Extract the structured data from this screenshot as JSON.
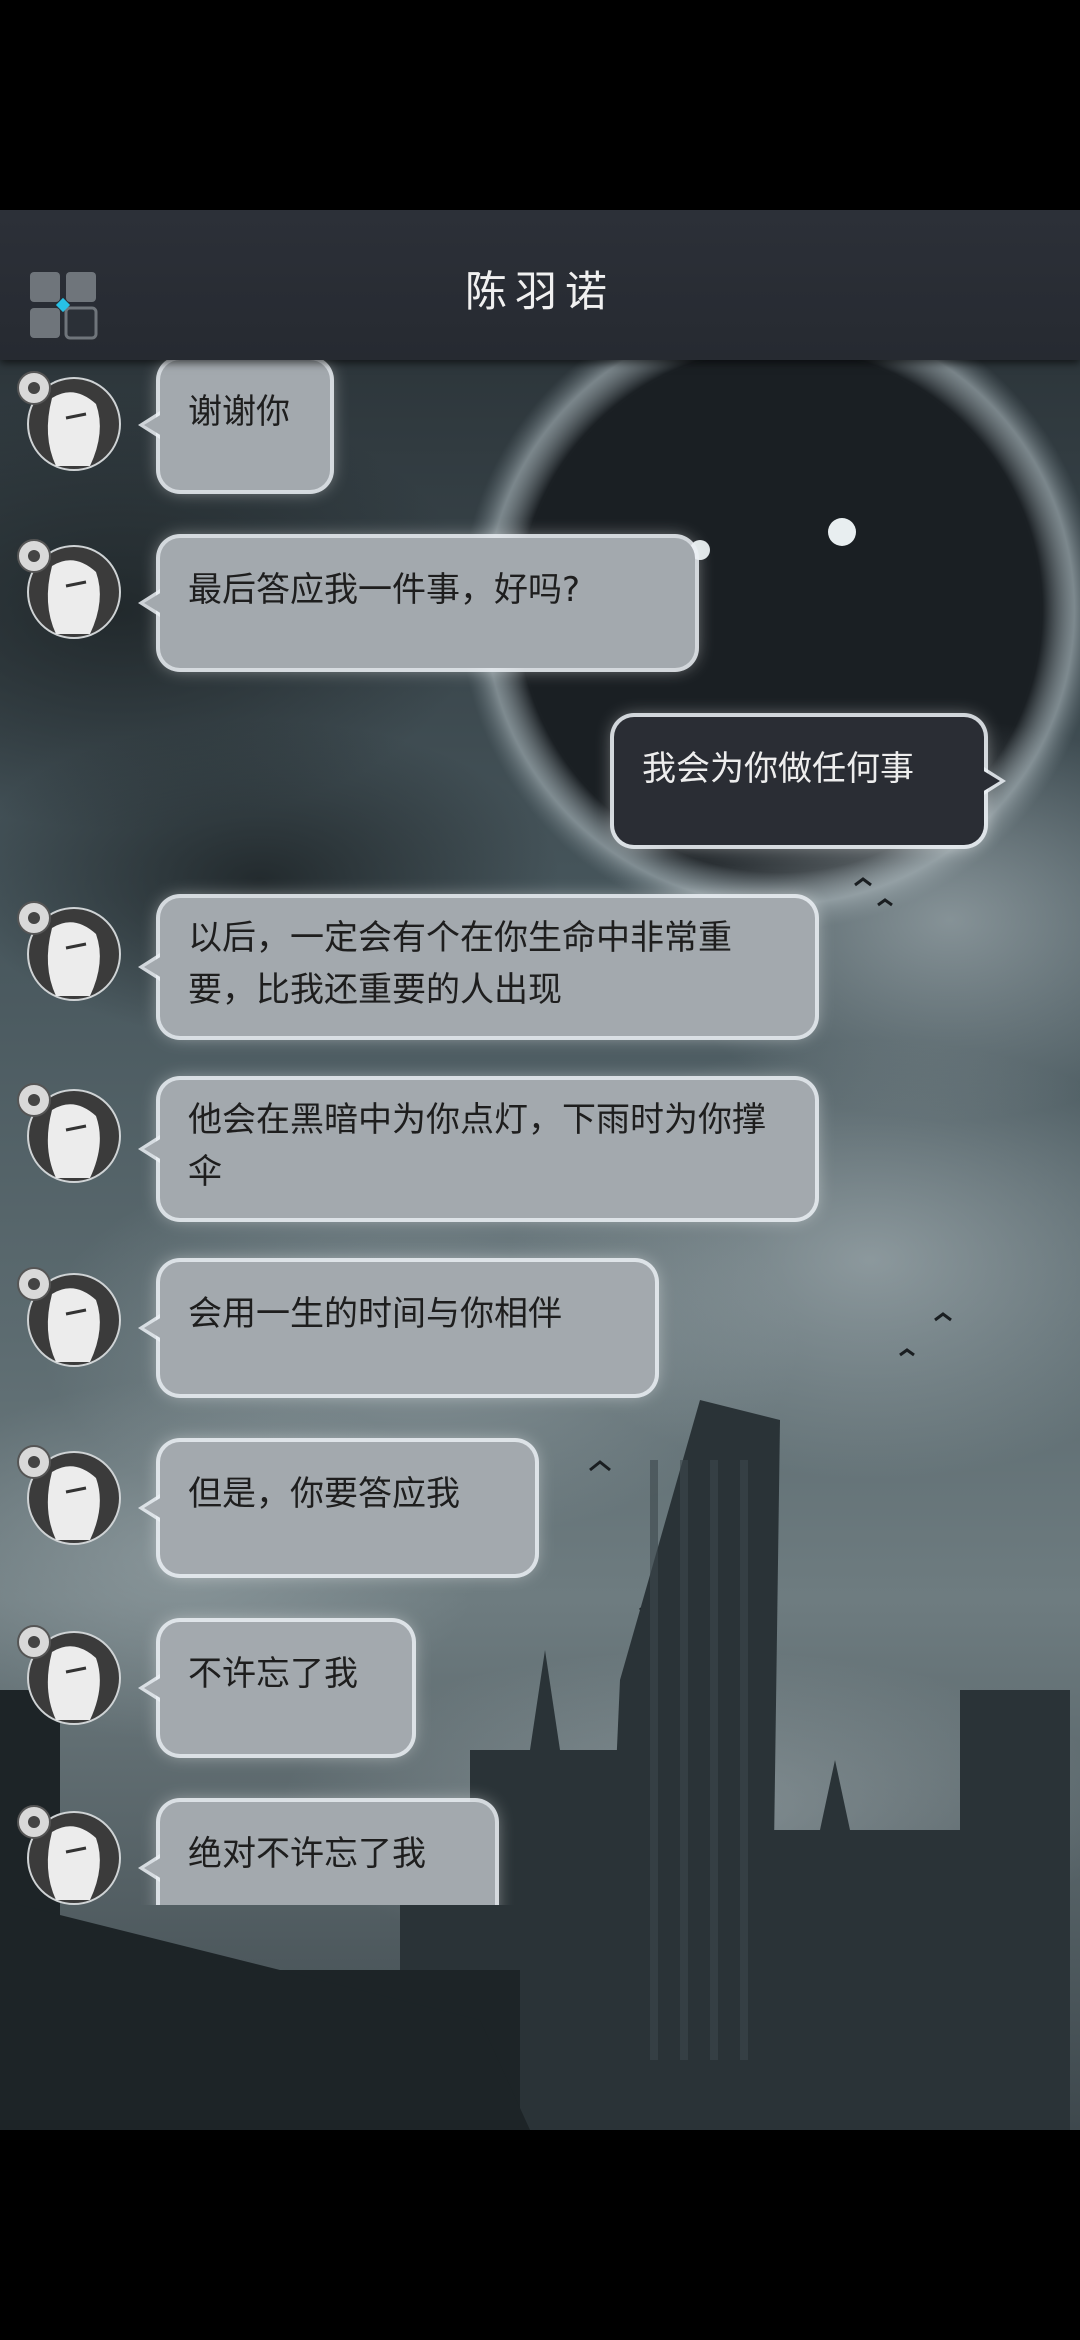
{
  "header": {
    "title": "陈羽诺",
    "menu_icon": "grid-menu-icon",
    "share_icon": "share-icon"
  },
  "colors": {
    "header_bg": "#2a2e35",
    "incoming_bubble": "#a3a9ae",
    "outgoing_bubble": "#2a2d34",
    "bubble_glow": "#ebf0f5"
  },
  "messages": [
    {
      "sender": "contact",
      "text": "谢谢你"
    },
    {
      "sender": "contact",
      "text": "最后答应我一件事，好吗?"
    },
    {
      "sender": "me",
      "text": "我会为你做任何事"
    },
    {
      "sender": "contact",
      "text": "以后，一定会有个在你生命中非常重要，比我还重要的人出现"
    },
    {
      "sender": "contact",
      "text": "他会在黑暗中为你点灯，下雨时为你撑伞"
    },
    {
      "sender": "contact",
      "text": "会用一生的时间与你相伴"
    },
    {
      "sender": "contact",
      "text": "但是，你要答应我"
    },
    {
      "sender": "contact",
      "text": "不许忘了我"
    },
    {
      "sender": "contact",
      "text": "绝对不许忘了我"
    }
  ]
}
